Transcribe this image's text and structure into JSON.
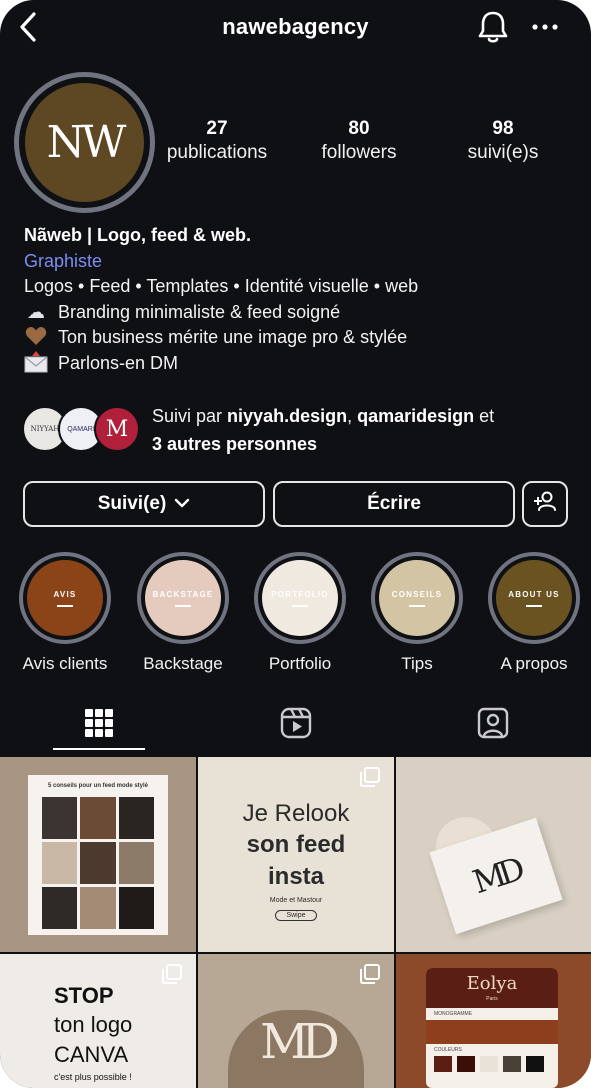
{
  "header": {
    "username": "nawebagency"
  },
  "profile": {
    "avatar_text": "NW",
    "stats": [
      {
        "value": "27",
        "label": "publications"
      },
      {
        "value": "80",
        "label": "followers"
      },
      {
        "value": "98",
        "label": "suivi(e)s"
      }
    ],
    "name": "Nãweb | Logo, feed & web.",
    "category": "Graphiste",
    "bio_lines": [
      {
        "emoji": "",
        "text": "Logos • Feed • Templates • Identité visuelle • web"
      },
      {
        "emoji": "☁",
        "text": "Branding minimaliste & feed soigné"
      },
      {
        "emoji": "🤎",
        "text": "Ton business mérite une image pro & stylée"
      },
      {
        "emoji": "✉",
        "text": "Parlons-en DM"
      }
    ]
  },
  "followed_by": {
    "prefix": "Suivi par ",
    "user1": "niyyah.design",
    "sep": ", ",
    "user2": "qamaridesign",
    "suffix": " et",
    "others": "3 autres personnes",
    "avatars": [
      {
        "text": "NIYYAH",
        "bg": "#e9e7e4",
        "fg": "#333333"
      },
      {
        "text": "QAMARI",
        "bg": "#eef0f6",
        "fg": "#2d2f5a"
      },
      {
        "text": "M",
        "bg": "#b0203a",
        "fg": "#ffffff"
      }
    ]
  },
  "actions": {
    "following_label": "Suivi(e)",
    "message_label": "Écrire"
  },
  "highlights": [
    {
      "word": "AVIS",
      "label": "Avis clients",
      "bg": "#8a4418",
      "fg": "#ffffff"
    },
    {
      "word": "BACKSTAGE",
      "label": "Backstage",
      "bg": "#e4cbbd",
      "fg": "#ffffff"
    },
    {
      "word": "PORTFOLIO",
      "label": "Portfolio",
      "bg": "#efe9e0",
      "fg": "#ffffff"
    },
    {
      "word": "CONSEILS",
      "label": "Tips",
      "bg": "#d3c4a4",
      "fg": "#ffffff"
    },
    {
      "word": "ABOUT US",
      "label": "A propos",
      "bg": "#6a5221",
      "fg": "#ffffff"
    }
  ],
  "posts": [
    {
      "type": "collage",
      "title": "5 conseils pour un feed mode stylé",
      "bg": "#a99682"
    },
    {
      "type": "text",
      "line1": "Je Relook",
      "line2": "son feed",
      "line3": "insta",
      "small": "Mode et Mastour",
      "btn": "Swipe",
      "bg": "#e7e1d6"
    },
    {
      "type": "card",
      "mark": "MD",
      "bg": "#d9d0c3"
    },
    {
      "type": "stop",
      "line1": "STOP",
      "line2": "ton logo",
      "line3": "CANVA",
      "small": "c'est plus possible !",
      "bg": "#efece7"
    },
    {
      "type": "logo",
      "mark": "MD",
      "bg": "#b7a896"
    },
    {
      "type": "brand",
      "name": "Eolya",
      "tag": "Paris",
      "sub1": "MONOGRAMME",
      "sub2": "COULEURS",
      "bg": "#8d4a2a"
    }
  ],
  "colors": {
    "background": "#0f1014",
    "category": "#7d8cf2",
    "ring": "#6f7480"
  }
}
